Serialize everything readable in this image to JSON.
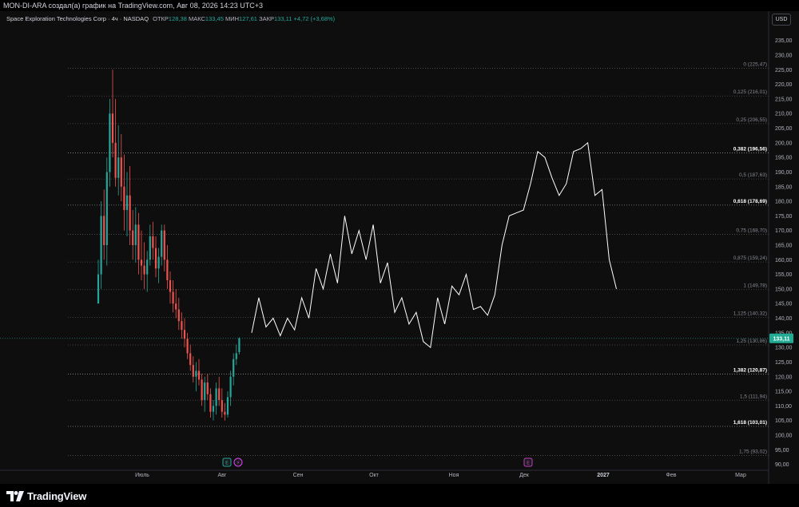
{
  "header": {
    "publisher_line": "MON-DI-ARA создал(а) график на TradingView.com, Авг 08, 2026 14:23 UTC+3"
  },
  "legend": {
    "symbol": "Space Exploration Technologies Corp · 4ч · NASDAQ",
    "open_label": "ОТКР",
    "open_value": "128,38",
    "high_label": "МАКС",
    "high_value": "133,45",
    "low_label": "МИН",
    "low_value": "127,61",
    "close_label": "ЗАКР",
    "close_value": "133,11",
    "change": "+4,72 (+3,68%)"
  },
  "currency_button": "USD",
  "brand": {
    "name": "TradingView",
    "colors": {
      "up": "#26a69a",
      "down": "#ef5350",
      "projection": "#ffffff",
      "price_label_bg": "#22ab94",
      "event_earnings": "#26a69a",
      "event_split": "#e040fb",
      "event_dividend": "#c040c0"
    }
  },
  "chart_data": {
    "type": "candlestick",
    "title": "",
    "price_scale": {
      "ticks": [
        "90,00",
        "95,00",
        "100,00",
        "105,00",
        "110,00",
        "115,00",
        "120,00",
        "125,00",
        "130,00",
        "135,00",
        "140,00",
        "145,00",
        "150,00",
        "155,00",
        "160,00",
        "165,00",
        "170,00",
        "175,00",
        "180,00",
        "185,00",
        "190,00",
        "195,00",
        "200,00",
        "205,00",
        "210,00",
        "215,00",
        "220,00",
        "225,00",
        "230,00",
        "235,00"
      ],
      "range": [
        88,
        242
      ]
    },
    "time_scale": {
      "ticks": [
        "Июль",
        "Авг",
        "Сен",
        "Окт",
        "Ноя",
        "Дек",
        "2027",
        "Фев",
        "Мар"
      ]
    },
    "last_price": {
      "label": "133,11",
      "value": 133.11
    },
    "candles_ohlc": [
      [
        145,
        160,
        149.5,
        155
      ],
      [
        155,
        180,
        150,
        175
      ],
      [
        175,
        184,
        160,
        165
      ],
      [
        165,
        195,
        158,
        190
      ],
      [
        190,
        215,
        185,
        210
      ],
      [
        210,
        225,
        195,
        200
      ],
      [
        200,
        215,
        185,
        188
      ],
      [
        188,
        206,
        182,
        195
      ],
      [
        195,
        203,
        180,
        185
      ],
      [
        185,
        196,
        170,
        177
      ],
      [
        177,
        190,
        168,
        182
      ],
      [
        182,
        192,
        165,
        170
      ],
      [
        170,
        177,
        160,
        165
      ],
      [
        165,
        178,
        159,
        172
      ],
      [
        172,
        176,
        155,
        160
      ],
      [
        160,
        170,
        153,
        158
      ],
      [
        158,
        166,
        150,
        155
      ],
      [
        155,
        163,
        149,
        160
      ],
      [
        160,
        172,
        158,
        168
      ],
      [
        168,
        173,
        160,
        164
      ],
      [
        164,
        168,
        154,
        157
      ],
      [
        157,
        164,
        152,
        161
      ],
      [
        161,
        172,
        158,
        170
      ],
      [
        170,
        172,
        156,
        160
      ],
      [
        160,
        165,
        150,
        153
      ],
      [
        153,
        156,
        145,
        149
      ],
      [
        149,
        153,
        142,
        145
      ],
      [
        145,
        150,
        140,
        143
      ],
      [
        143,
        147,
        136,
        139
      ],
      [
        139,
        142,
        133,
        136
      ],
      [
        136,
        140,
        130,
        133
      ],
      [
        133,
        135,
        126,
        128
      ],
      [
        128,
        131,
        122,
        124
      ],
      [
        124,
        127,
        118,
        120
      ],
      [
        120,
        125,
        115,
        122
      ],
      [
        122,
        126,
        117,
        119
      ],
      [
        119,
        121,
        110,
        112
      ],
      [
        112,
        120,
        108,
        118
      ],
      [
        118,
        121,
        112,
        114
      ],
      [
        114,
        116,
        106,
        108
      ],
      [
        108,
        112,
        105,
        110
      ],
      [
        110,
        118,
        107,
        116
      ],
      [
        116,
        120,
        110,
        112
      ],
      [
        112,
        116,
        106,
        108
      ],
      [
        108,
        111,
        105,
        107
      ],
      [
        107,
        115,
        106,
        113
      ],
      [
        113,
        122,
        110,
        120
      ],
      [
        120,
        128,
        117,
        126
      ],
      [
        126,
        131,
        124,
        128
      ],
      [
        128.38,
        133.45,
        127.61,
        133.11
      ]
    ],
    "projection_path": [
      [
        0,
        135
      ],
      [
        1,
        147
      ],
      [
        2,
        137
      ],
      [
        3,
        140
      ],
      [
        4,
        134
      ],
      [
        5,
        140
      ],
      [
        6,
        136
      ],
      [
        7,
        147
      ],
      [
        8,
        140
      ],
      [
        9,
        157
      ],
      [
        10,
        150
      ],
      [
        11,
        162
      ],
      [
        12,
        152
      ],
      [
        13,
        175
      ],
      [
        14,
        162
      ],
      [
        15,
        170
      ],
      [
        16,
        160
      ],
      [
        17,
        172
      ],
      [
        18,
        152
      ],
      [
        19,
        159
      ],
      [
        20,
        142
      ],
      [
        21,
        147
      ],
      [
        22,
        138
      ],
      [
        23,
        142
      ],
      [
        24,
        132
      ],
      [
        25,
        130
      ],
      [
        26,
        147
      ],
      [
        27,
        138
      ],
      [
        28,
        151
      ],
      [
        29,
        148
      ],
      [
        30,
        155
      ],
      [
        31,
        143
      ],
      [
        32,
        144
      ],
      [
        33,
        141
      ],
      [
        34,
        148
      ],
      [
        35,
        165
      ],
      [
        36,
        175
      ],
      [
        37,
        176
      ],
      [
        38,
        177
      ],
      [
        39,
        186
      ],
      [
        40,
        197
      ],
      [
        41,
        195
      ],
      [
        42,
        188
      ],
      [
        43,
        182
      ],
      [
        44,
        186
      ],
      [
        45,
        197
      ],
      [
        46,
        198
      ],
      [
        47,
        200
      ],
      [
        48,
        182
      ],
      [
        49,
        184
      ],
      [
        50,
        160
      ],
      [
        51,
        150
      ]
    ],
    "fibonacci": [
      {
        "level": "0",
        "price": 225.47,
        "label": "0 (225,47)",
        "emphasis": false
      },
      {
        "level": "0,125",
        "price": 216.01,
        "label": "0,125 (216,01)",
        "emphasis": false
      },
      {
        "level": "0,25",
        "price": 206.55,
        "label": "0,25 (206,55)",
        "emphasis": false
      },
      {
        "level": "0,382",
        "price": 196.56,
        "label": "0,382 (196,56)",
        "emphasis": true
      },
      {
        "level": "0,5",
        "price": 187.63,
        "label": "0,5 (187,63)",
        "emphasis": false
      },
      {
        "level": "0,618",
        "price": 178.69,
        "label": "0,618 (178,69)",
        "emphasis": true
      },
      {
        "level": "0,75",
        "price": 168.7,
        "label": "0,75 (168,70)",
        "emphasis": false
      },
      {
        "level": "0,875",
        "price": 159.24,
        "label": "0,875 (159,24)",
        "emphasis": false
      },
      {
        "level": "1",
        "price": 149.78,
        "label": "1 (149,78)",
        "emphasis": false
      },
      {
        "level": "1,125",
        "price": 140.32,
        "label": "1,125 (140,32)",
        "emphasis": false
      },
      {
        "level": "1,25",
        "price": 130.86,
        "label": "1,25 (130,86)",
        "emphasis": false
      },
      {
        "level": "1,382",
        "price": 120.87,
        "label": "1,382 (120,87)",
        "emphasis": true
      },
      {
        "level": "1,5",
        "price": 111.94,
        "label": "1,5 (111,94)",
        "emphasis": false
      },
      {
        "level": "1,618",
        "price": 103.01,
        "label": "1,618 (103,01)",
        "emphasis": true
      },
      {
        "level": "1,75",
        "price": 93.02,
        "label": "1,75 (93,02)",
        "emphasis": false
      }
    ],
    "events": [
      {
        "name": "earnings",
        "symbol": "E",
        "time": "Авг"
      },
      {
        "name": "split",
        "symbol": "⚡",
        "time": "Авг"
      },
      {
        "name": "earnings",
        "symbol": "E",
        "time": "Дек"
      }
    ],
    "grid": true
  }
}
